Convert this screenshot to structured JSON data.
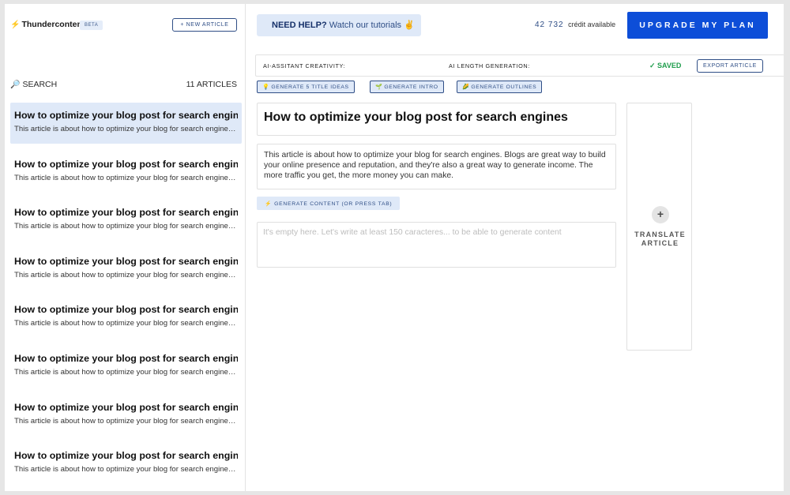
{
  "sidebar": {
    "brand_icon": "lightning-icon",
    "brand_name": "Thundercontent",
    "beta_label": "BETA",
    "new_article_label": "+ NEW ARTICLE",
    "search_icon": "magnifier-icon",
    "search_label": "SEARCH",
    "articles_count": "11 ARTICLES",
    "items": [
      {
        "title": "How to optimize your blog post for search engines",
        "desc": "This article is about how to optimize your blog for search engines. Blogs are great way to",
        "active": true
      },
      {
        "title": "How to optimize your blog post for search engines",
        "desc": "This article is about how to optimize your blog for search engines. Blogs are great way to"
      },
      {
        "title": "How to optimize your blog post for search engines",
        "desc": "This article is about how to optimize your blog for search engines. Blogs are great way to"
      },
      {
        "title": "How to optimize your blog post for search engines",
        "desc": "This article is about how to optimize your blog for search engines. Blogs are great way to"
      },
      {
        "title": "How to optimize your blog post for search engines",
        "desc": "This article is about how to optimize your blog for search engines. Blogs are great way to"
      },
      {
        "title": "How to optimize your blog post for search engines",
        "desc": "This article is about how to optimize your blog for search engines. Blogs are great way to"
      },
      {
        "title": "How to optimize your blog post for search engines",
        "desc": "This article is about how to optimize your blog for search engines. Blogs are great way to"
      },
      {
        "title": "How to optimize your blog post for search engines",
        "desc": "This article is about how to optimize your blog for search engines. Blogs are great way to"
      }
    ]
  },
  "header": {
    "help_strong": "NEED HELP?",
    "help_text": "Watch our tutorials ✌",
    "credits_value": "42 732",
    "credits_text": "crédit available",
    "upgrade_label": "UPGRADE MY PLAN"
  },
  "settings": {
    "creativity_label": "AI-ASSITANT CREATIVITY:",
    "length_label": "AI LENGTH GENERATION:",
    "saved_label": "✓ SAVED",
    "export_label": "EXPORT ARTICLE"
  },
  "generators": {
    "title_ideas": {
      "icon": "💡",
      "label": "GENERATE 5 TITLE IDEAS"
    },
    "intro": {
      "icon": "🌱",
      "label": "GENERATE INTRO"
    },
    "outlines": {
      "icon": "🌽",
      "label": "GENERATE OUTLINES"
    }
  },
  "editor": {
    "title": "How to optimize your blog post for search engines",
    "intro": "This article is about how to optimize your blog for search engines. Blogs are great way to build your online presence and reputation, and they're also a great way to generate income. The more traffic you get, the more money you can make.",
    "generate_content_icon": "⚡",
    "generate_content_label": "GENERATE CONTENT (OR PRESS TAB)",
    "content_placeholder": "It's empty here. Let's write at least 150 caracteres... to be able to generate content"
  },
  "translate": {
    "plus": "+",
    "label": "TRANSLATE ARTICLE"
  },
  "colors": {
    "accent": "#0d4ed8",
    "navy": "#2f4e86",
    "light_blue": "#dfe9f8",
    "saved_green": "#1f9d4c"
  }
}
